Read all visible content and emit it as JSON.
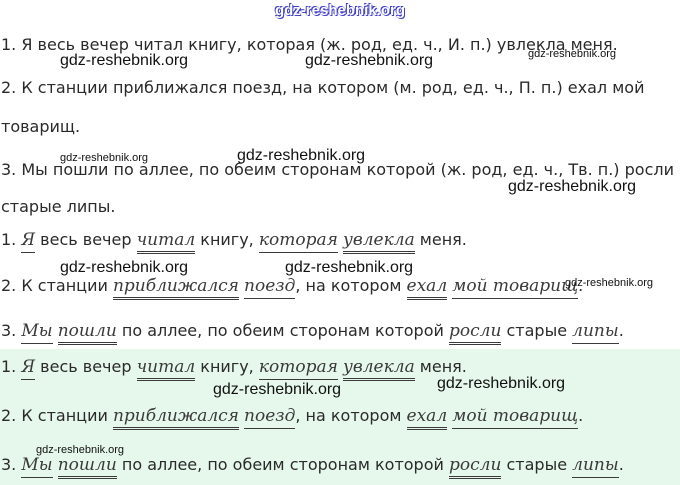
{
  "header": {
    "site": "gdz-reshebnik.org"
  },
  "watermark": "gdz-reshebnik.org",
  "block1": {
    "s1": "1. Я весь вечер читал книгу, которая (ж. род, ед. ч., И. п.) увлекла меня.",
    "s2a": "2. К станции приближался поезд, на котором (м. род, ед. ч., П. п.) ехал мой",
    "s2b": "товарищ.",
    "s3a": "3. Мы пошли по аллее, по обеим сторонам которой (ж. род, ед. ч., Тв. п.) росли",
    "s3b": "старые липы."
  },
  "block2": {
    "s1": {
      "n": "1. ",
      "w1": "Я",
      "t1": " весь вечер ",
      "w2": "читал",
      "t2": " книгу, ",
      "w3": "которая",
      "t3": " ",
      "w4": "увлекла",
      "t4": " меня."
    },
    "s2": {
      "n": "2. К станции ",
      "w1": "приближался",
      "t1": " ",
      "w2": "поезд",
      "t2": ", на котором ",
      "w3": "ехал",
      "t3": " ",
      "w4": "мой товарищ",
      "t4": "."
    },
    "s3": {
      "n": "3. ",
      "w1": "Мы",
      "t1": " ",
      "w2": "пошли",
      "t2": " по аллее, по обеим сторонам которой ",
      "w3": "росли",
      "t3": " старые ",
      "w4": "липы",
      "t4": "."
    }
  },
  "block3": {
    "s1": {
      "n": "1. ",
      "w1": "Я",
      "t1": " весь вечер ",
      "w2": "читал",
      "t2": " книгу, ",
      "w3": "которая",
      "t3": " ",
      "w4": "увлекла",
      "t4": " меня."
    },
    "s2": {
      "n": "2. К станции ",
      "w1": "приближался",
      "t1": " ",
      "w2": "поезд",
      "t2": ", на котором ",
      "w3": "ехал",
      "t3": " ",
      "w4": "мой товарищ",
      "t4": "."
    },
    "s3": {
      "n": "3. ",
      "w1": "Мы",
      "t1": " ",
      "w2": "пошли",
      "t2": " по аллее, по обеим сторонам которой ",
      "w3": "росли",
      "t3": " старые ",
      "w4": "липы",
      "t4": "."
    }
  },
  "colors": {
    "green_band": "#e6f8ec",
    "header_outline": "#4040c8"
  }
}
